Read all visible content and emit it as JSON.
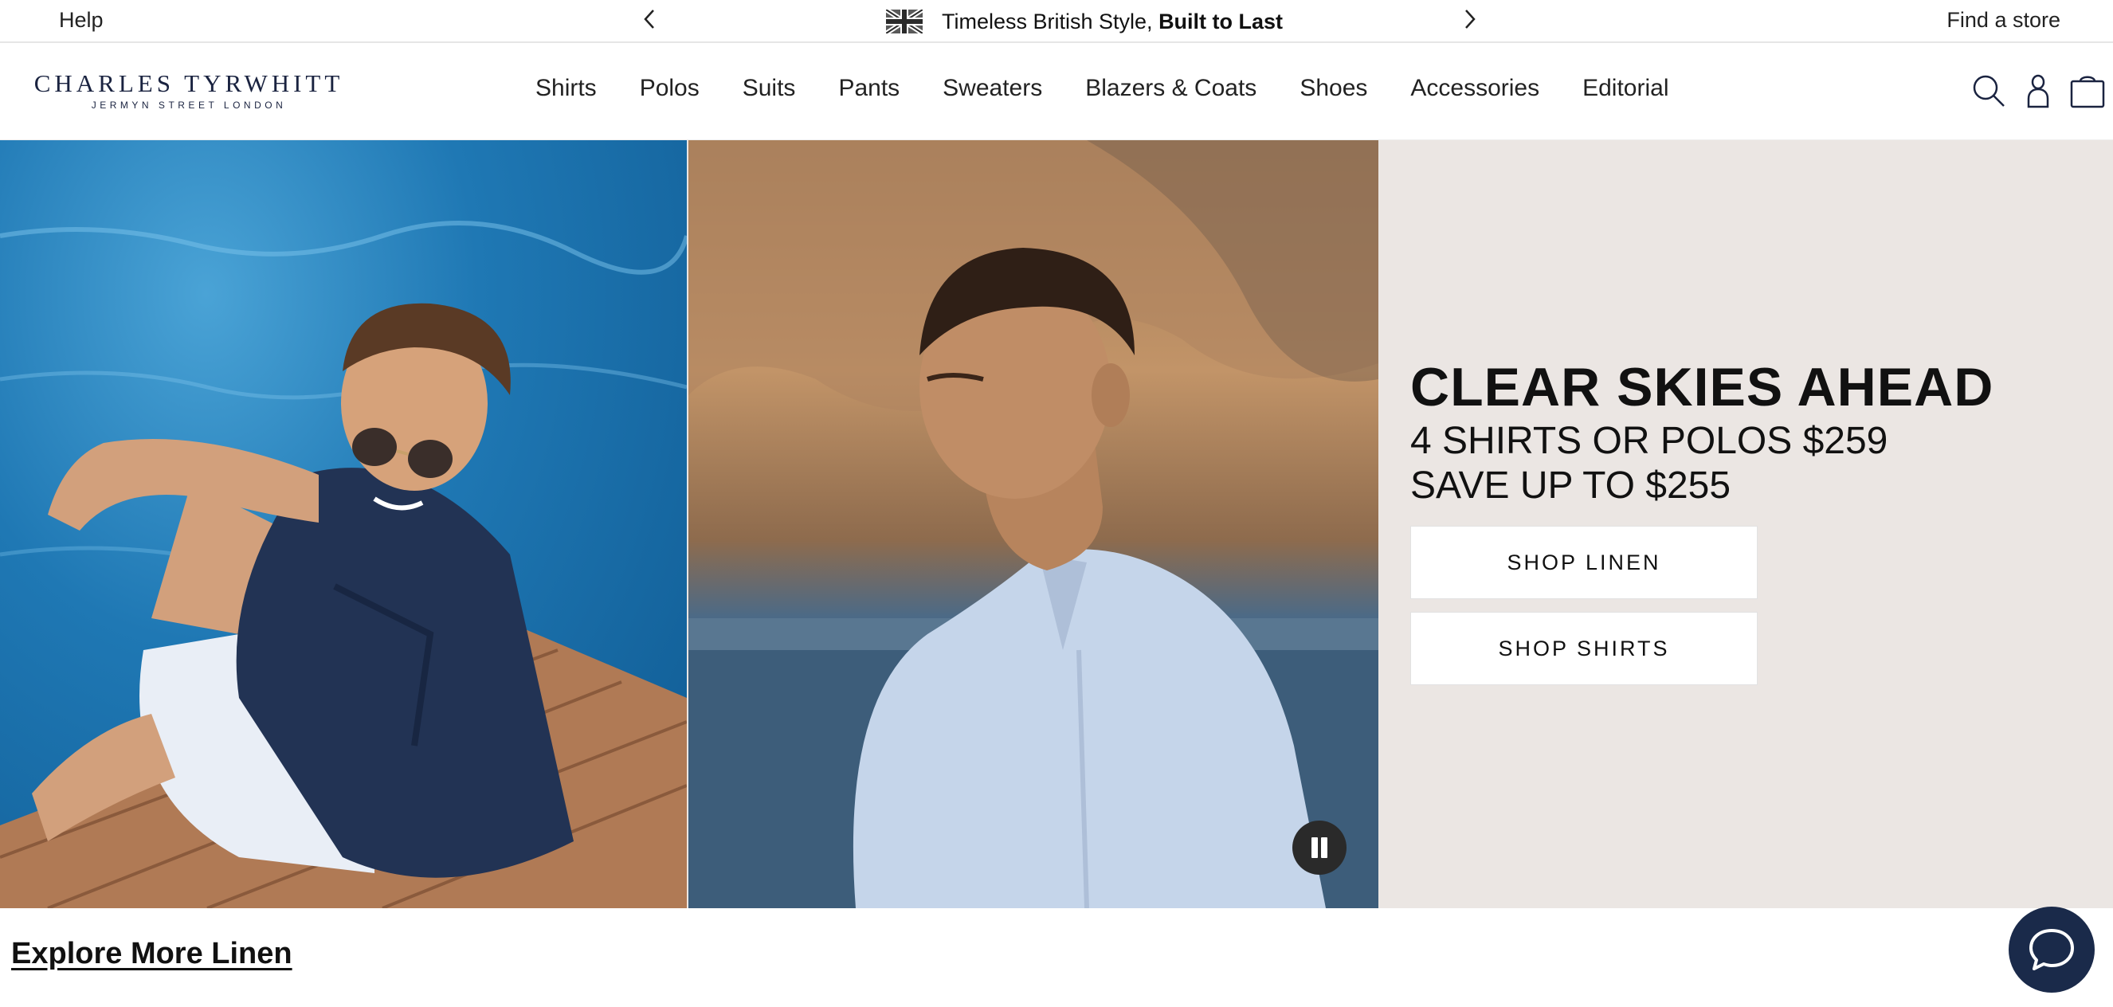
{
  "announcement": {
    "help_label": "Help",
    "promo_text": "Timeless British Style, ",
    "promo_bold": "Built to Last",
    "find_store_label": "Find a store",
    "icons": [
      "chevron-left-icon",
      "union-jack-flag-icon",
      "chevron-right-icon"
    ]
  },
  "header": {
    "brand_name": "CHARLES TYRWHITT",
    "brand_tagline": "JERMYN STREET LONDON",
    "nav": [
      {
        "label": "Shirts"
      },
      {
        "label": "Polos"
      },
      {
        "label": "Suits"
      },
      {
        "label": "Pants"
      },
      {
        "label": "Sweaters"
      },
      {
        "label": "Blazers & Coats"
      },
      {
        "label": "Shoes"
      },
      {
        "label": "Accessories"
      },
      {
        "label": "Editorial"
      }
    ],
    "icons": [
      "search-icon",
      "account-icon",
      "shopping-bag-icon"
    ]
  },
  "hero": {
    "title": "CLEAR SKIES AHEAD",
    "subtitle_line1": "4 SHIRTS OR POLOS $259",
    "subtitle_line2": "SAVE UP TO $255",
    "cta_primary": "SHOP LINEN",
    "cta_secondary": "SHOP SHIRTS",
    "images": [
      "man-in-navy-linen-shirt-on-dock",
      "man-in-light-blue-shirt-by-sea"
    ],
    "controls": [
      "pause-icon"
    ]
  },
  "below_hero": {
    "explore_label": "Explore More Linen",
    "chat_icon": "chat-bubble-icon"
  },
  "colors": {
    "brand_navy": "#1a2340",
    "hero_panel_bg": "#ebe6e3",
    "chat_button_bg": "#1a2a4a"
  }
}
